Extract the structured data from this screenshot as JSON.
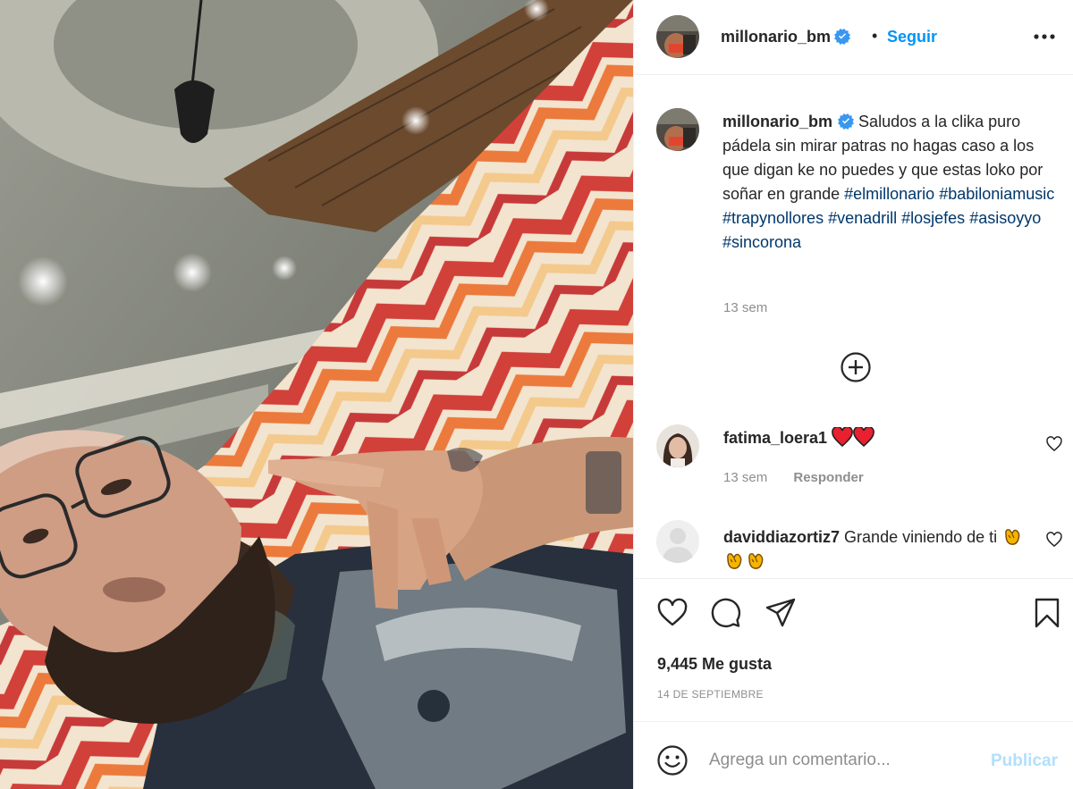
{
  "post": {
    "username": "millonario_bm",
    "follow_label": "Seguir",
    "dot": "•",
    "more_icon": "more-options-icon"
  },
  "caption": {
    "username": "millonario_bm",
    "text": "Saludos a la clika puro pádela sin mirar patras no hagas caso a los que digan ke no puedes y que estas loko por soñar en grande",
    "hashtags": [
      "#elmillonario",
      "#babiloniamusic",
      "#trapynollores",
      "#venadrill",
      "#losjefes",
      "#asisoyyo",
      "#sincorona"
    ],
    "time": "13 sem"
  },
  "comments": [
    {
      "username": "fatima_loera1",
      "emoji": [
        "red-heart-emoji",
        "red-heart-emoji"
      ],
      "time": "13 sem",
      "reply_label": "Responder"
    },
    {
      "username": "daviddiazortiz7",
      "text": "Grande viniendo de ti",
      "emoji": [
        "clapping-hands-emoji",
        "clapping-hands-emoji",
        "clapping-hands-emoji"
      ]
    }
  ],
  "actions": {
    "likes": "9,445 Me gusta",
    "date": "14 DE SEPTIEMBRE"
  },
  "composer": {
    "placeholder": "Agrega un comentario...",
    "publish_label": "Publicar"
  },
  "colors": {
    "link_blue": "#0095f6",
    "hashtag": "#00376b",
    "muted": "#8e8e8e",
    "publish_disabled": "#b2dffc",
    "heart_red": "#ed4956"
  }
}
